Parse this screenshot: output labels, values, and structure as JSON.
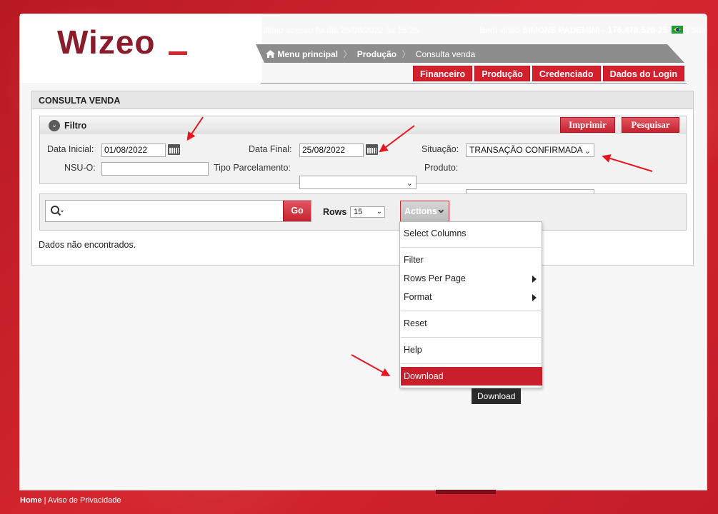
{
  "brand": {
    "logo_text": "Wizeo",
    "accent": "#d4262f"
  },
  "header": {
    "last_access": "Seu último acesso foi dia 25/08/2022 às 15:25.",
    "welcome_prefix": "Bem vindo",
    "user_name": "SIMONE PADEMINI",
    "user_id": "- 176.478.528-25",
    "logout": "| Sair"
  },
  "breadcrumb": [
    {
      "label": "Menu principal",
      "icon": "home-icon"
    },
    {
      "label": "Produção"
    },
    {
      "label": "Consulta venda"
    }
  ],
  "topnav": [
    "Financeiro",
    "Produção",
    "Credenciado",
    "Dados do Login"
  ],
  "page": {
    "title": "CONSULTA VENDA",
    "filter_label": "Filtro",
    "print_button": "Imprimir",
    "search_button": "Pesquisar"
  },
  "filters": {
    "data_inicial_label": "Data Inicial:",
    "data_inicial_value": "01/08/2022",
    "data_final_label": "Data Final:",
    "data_final_value": "25/08/2022",
    "situacao_label": "Situação:",
    "situacao_value": "TRANSAÇÃO CONFIRMADA",
    "nsu_label": "NSU-O:",
    "nsu_value": "",
    "tipo_parcelamento_label": "Tipo Parcelamento:",
    "tipo_parcelamento_value": "",
    "produto_label": "Produto:",
    "produto_value": ""
  },
  "report": {
    "search_value": "",
    "go_button": "Go",
    "rows_label": "Rows",
    "rows_value": "15",
    "actions_button": "Actions",
    "no_data": "Dados não encontrados."
  },
  "actions_menu": {
    "select_columns": "Select Columns",
    "filter": "Filter",
    "rows_per_page": "Rows Per Page",
    "format": "Format",
    "reset": "Reset",
    "help": "Help",
    "download": "Download"
  },
  "tooltip": "Download",
  "footer": {
    "home": "Home",
    "privacy": "| Aviso de Privacidade"
  }
}
